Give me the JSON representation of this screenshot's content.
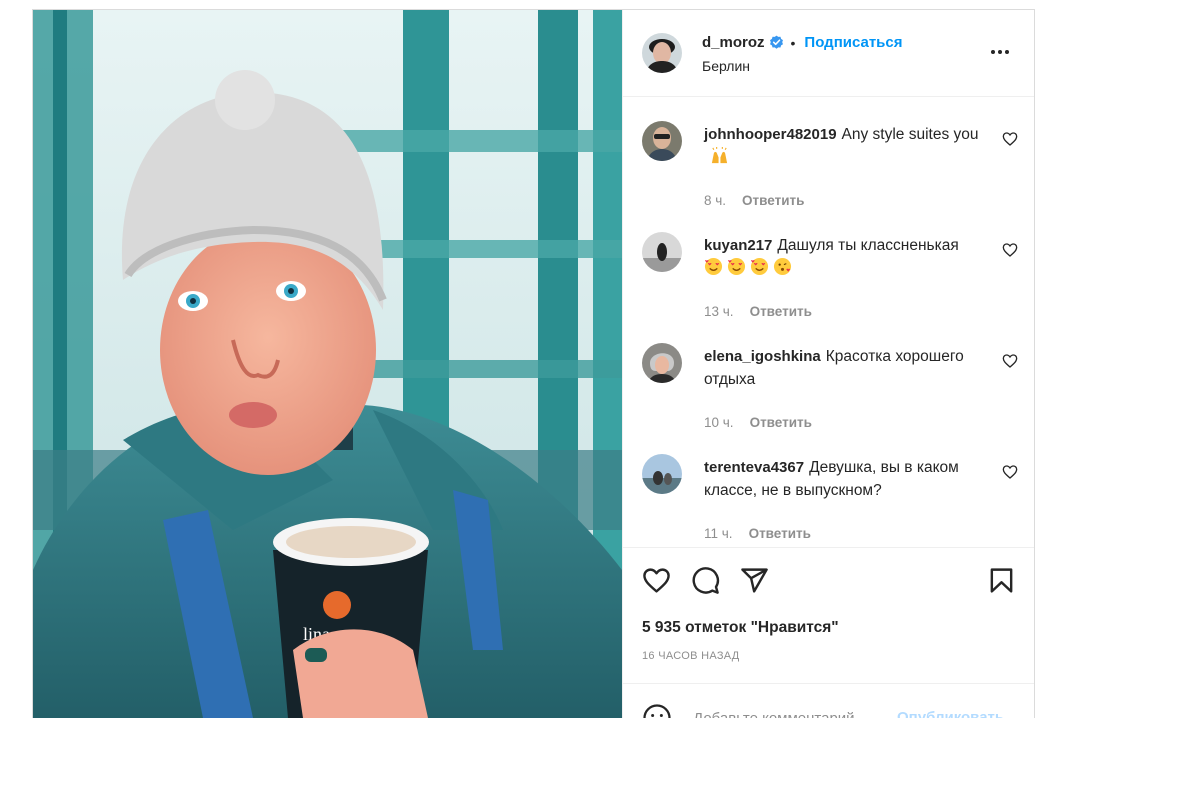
{
  "post": {
    "author": {
      "username": "d_moroz",
      "verified": true,
      "follow_label": "Подписаться",
      "separator": "•",
      "location": "Берлин",
      "avatar_icon": "avatar-photo"
    },
    "photo": {
      "cup_text": "lina"
    },
    "comments": [
      {
        "username": "johnhooper482019",
        "text": "Any style suites you",
        "emoji": [
          "raising-hands"
        ],
        "time": "8 ч.",
        "reply_label": "Ответить"
      },
      {
        "username": "kuyan217",
        "text": "Дашуля ты классненькая",
        "emoji": [
          "smiling-face-with-hearts",
          "smiling-face-with-hearts",
          "smiling-face-with-hearts",
          "face-blowing-kiss"
        ],
        "time": "13 ч.",
        "reply_label": "Ответить"
      },
      {
        "username": "elena_igoshkina",
        "text": "Красотка хорошего отдыха",
        "emoji": [],
        "time": "10 ч.",
        "reply_label": "Ответить"
      },
      {
        "username": "terenteva4367",
        "text": "Девушка, вы в каком классе, не в выпускном?",
        "emoji": [],
        "time": "11 ч.",
        "reply_label": "Ответить"
      }
    ],
    "actions": {
      "icons": [
        "heart-icon",
        "comment-icon",
        "share-icon",
        "bookmark-icon"
      ]
    },
    "likes_text": "5 935 отметок \"Нравится\"",
    "posted_ago": "16 ЧАСОВ НАЗАД",
    "add_comment": {
      "placeholder": "Добавьте комментарий...",
      "publish_label": "Опубликовать"
    }
  },
  "colors": {
    "link_blue": "#0095f6",
    "publish_disabled": "#b3dbff",
    "secondary_text": "#8e8e8e",
    "border": "#dbdbdb",
    "verified_badge": "#3897f0"
  }
}
